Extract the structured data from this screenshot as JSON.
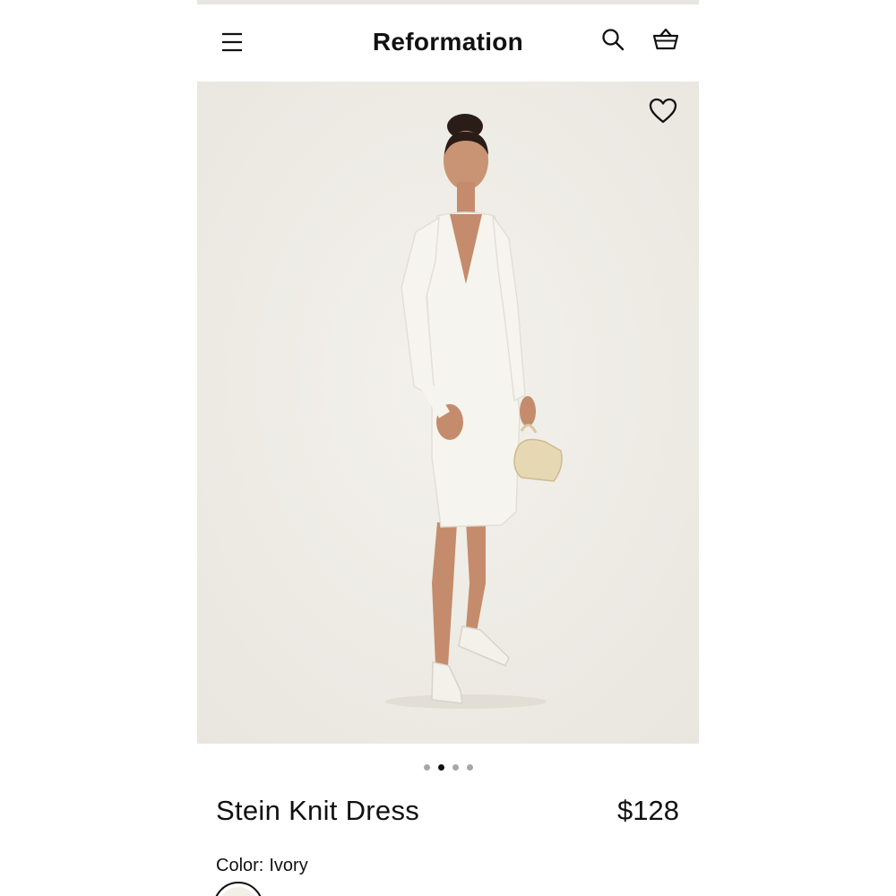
{
  "header": {
    "brand": "Reformation",
    "menu_icon": "hamburger-menu-icon",
    "search_icon": "search-icon",
    "bag_icon": "shopping-basket-icon"
  },
  "gallery": {
    "favorite_icon": "heart-outline-icon",
    "image_alt": "Model wearing an ivory long-sleeve knit midi dress holding a cream handbag",
    "slide_count": 4,
    "active_slide": 2,
    "background_color": "#efece6"
  },
  "product": {
    "name": "Stein Knit Dress",
    "price": "$128",
    "color_label": "Color:",
    "color_value": "Ivory",
    "swatch_color": "#f1efe8"
  }
}
